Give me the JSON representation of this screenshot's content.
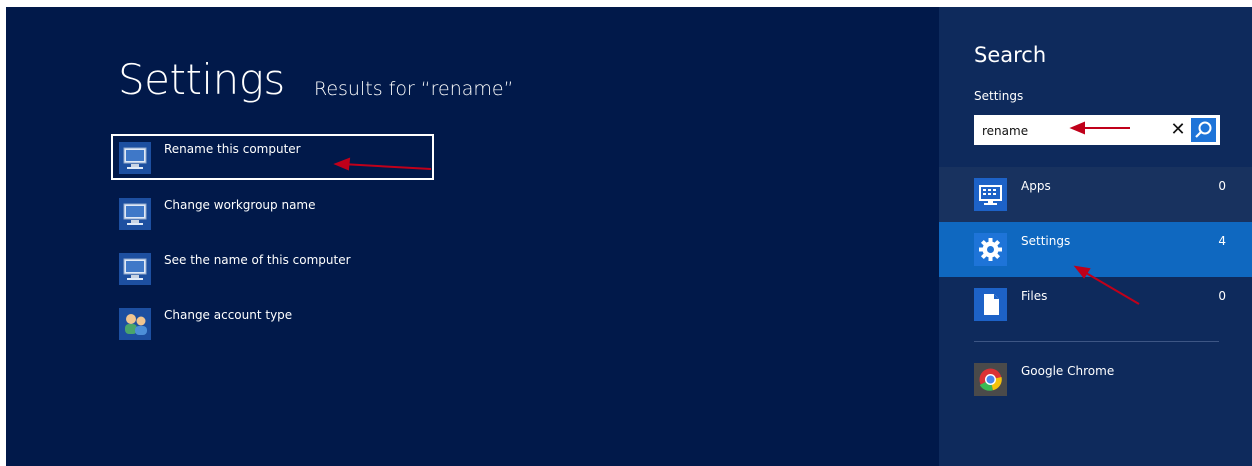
{
  "results": {
    "title": "Settings",
    "subtitle": "Results for “rename”",
    "items": [
      {
        "label": "Rename this computer"
      },
      {
        "label": "Change workgroup name"
      },
      {
        "label": "See the name of this computer"
      },
      {
        "label": "Change account type"
      }
    ]
  },
  "search_pane": {
    "title": "Search",
    "scope": "Settings",
    "query": "rename",
    "clear_icon": "✕",
    "categories": [
      {
        "label": "Apps",
        "count": "0",
        "icon": "apps-keyboard-icon"
      },
      {
        "label": "Settings",
        "count": "4",
        "icon": "gear-icon"
      },
      {
        "label": "Files",
        "count": "0",
        "icon": "file-icon"
      },
      {
        "label": "Google Chrome",
        "icon": "chrome-icon"
      }
    ]
  },
  "colors": {
    "background": "#01194a",
    "pane": "#0e2a5c",
    "selected_category": "#0f68c0",
    "annotation_arrow": "#c0001a"
  }
}
